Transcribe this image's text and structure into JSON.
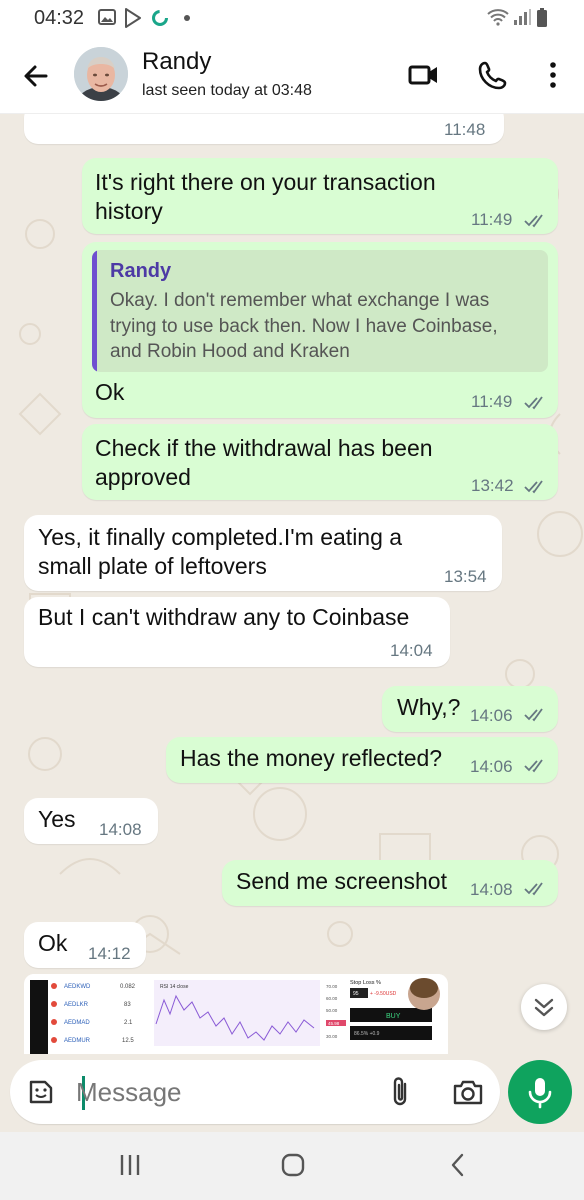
{
  "status_bar": {
    "time": "04:32"
  },
  "header": {
    "contact_name": "Randy",
    "last_seen": "last seen today at 03:48"
  },
  "messages": [
    {
      "id": "m0",
      "direction": "incoming",
      "time": "11:48"
    },
    {
      "id": "m1",
      "direction": "outgoing",
      "lines": [
        "It's right there on your transaction",
        "history"
      ],
      "time": "11:49",
      "status": "read"
    },
    {
      "id": "m2",
      "direction": "outgoing",
      "quote": {
        "author": "Randy",
        "lines": [
          "Okay. I don't remember what exchange I was",
          "trying to use back then. Now I have Coinbase,",
          "and Robin Hood and Kraken"
        ]
      },
      "lines": [
        "Ok"
      ],
      "time": "11:49",
      "status": "read"
    },
    {
      "id": "m3",
      "direction": "outgoing",
      "lines": [
        "Check if the withdrawal has been",
        "approved"
      ],
      "time": "13:42",
      "status": "read"
    },
    {
      "id": "m4",
      "direction": "incoming",
      "lines": [
        "Yes, it finally completed.I'm eating a",
        "small plate of leftovers"
      ],
      "time": "13:54"
    },
    {
      "id": "m5",
      "direction": "incoming",
      "lines": [
        "But I can't withdraw any to Coinbase"
      ],
      "time": "14:04"
    },
    {
      "id": "m6",
      "direction": "outgoing",
      "lines": [
        "Why,?"
      ],
      "time": "14:06",
      "status": "read"
    },
    {
      "id": "m7",
      "direction": "outgoing",
      "lines": [
        "Has the money reflected?"
      ],
      "time": "14:06",
      "status": "read"
    },
    {
      "id": "m8",
      "direction": "incoming",
      "lines": [
        "Yes"
      ],
      "time": "14:08"
    },
    {
      "id": "m9",
      "direction": "outgoing",
      "lines": [
        "Send me screenshot"
      ],
      "time": "14:08",
      "status": "read"
    },
    {
      "id": "m10",
      "direction": "incoming",
      "lines": [
        "Ok"
      ],
      "time": "14:12"
    }
  ],
  "image_preview": {
    "pairs": [
      "AEDKWD",
      "AEDLKR",
      "AEDMAD",
      "AEDMUR"
    ],
    "pair_values": [
      "0.082",
      "83",
      "2.1",
      "12.5"
    ],
    "rsi_label": "RSI 14 close",
    "scale": [
      "70.00",
      "60.00",
      "50.00",
      "40.00",
      "30.00"
    ],
    "rsi_marker": "45.98",
    "stop_loss": "Stop Loss %",
    "stop_value": "95",
    "stop_usd": "+ -9.50USD",
    "buy_label": "BUY",
    "buy_sub": "86.5% +0.9"
  },
  "input": {
    "placeholder": "Message"
  },
  "colors": {
    "outgoing_bubble": "#d9fdd3",
    "incoming_bubble": "#ffffff",
    "chat_bg": "#efeae2",
    "accent_green": "#0fa35e",
    "read_ticks": "#667781",
    "quote_bar": "#6f4fd0"
  },
  "icons": {
    "status": [
      "gallery-icon",
      "play-store-icon",
      "sync-icon",
      "wifi-icon",
      "signal-icon",
      "battery-icon"
    ],
    "header": [
      "back-arrow-icon",
      "video-call-icon",
      "voice-call-icon",
      "more-options-icon"
    ],
    "input": [
      "sticker-icon",
      "attach-icon",
      "camera-icon",
      "mic-icon"
    ],
    "nav": [
      "recents-icon",
      "home-icon",
      "back-icon"
    ]
  }
}
